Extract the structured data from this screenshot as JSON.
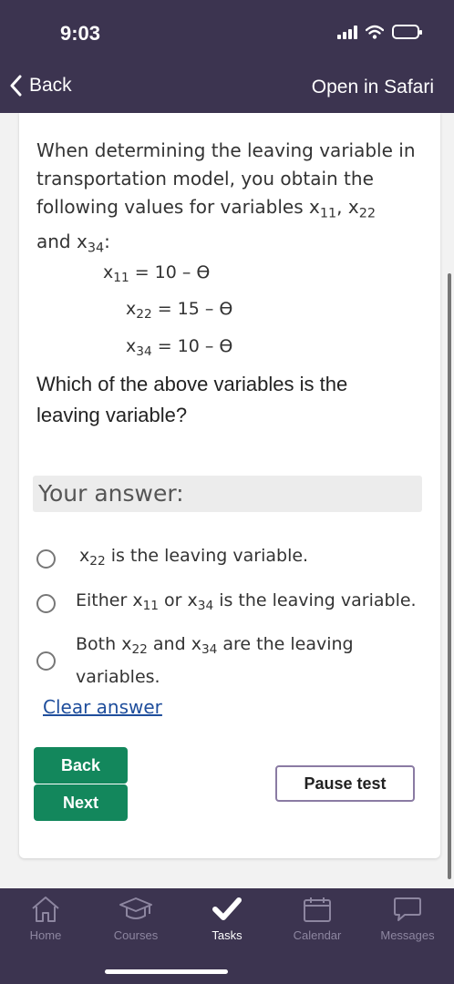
{
  "status_bar": {
    "time": "9:03"
  },
  "browser_nav": {
    "back_label": "Back",
    "open_label": "Open in Safari"
  },
  "question": {
    "intro_part1": "When determining the leaving variable in transportation model, you obtain the following values for variables ",
    "var_x11": "x",
    "sub_11": "11",
    "comma": ", ",
    "var_x22": "x",
    "sub_22": "22",
    "and_text": "and ",
    "var_x34": "x",
    "sub_34": "34",
    "colon": ":",
    "equations": [
      {
        "var": "x",
        "sub": "11",
        "rhs": " = 10 – ϴ"
      },
      {
        "var": "x",
        "sub": "22",
        "rhs": " = 15 – ϴ"
      },
      {
        "var": "x",
        "sub": "34",
        "rhs": " = 10 – ϴ"
      }
    ],
    "prompt": "Which of the above variables is the leaving variable?"
  },
  "answer_section": {
    "heading": "Your answer:",
    "options": [
      {
        "v1": "x",
        "s1": "22",
        "rest": " is the leaving variable."
      },
      {
        "pre": "Either ",
        "v1": "x",
        "s1": "11",
        "mid": " or ",
        "v2": "x",
        "s2": "34",
        "rest": " is the leaving variable."
      },
      {
        "pre": "Both ",
        "v1": "x",
        "s1": "22",
        "mid": " and ",
        "v2": "x",
        "s2": "34",
        "rest": " are the leaving variables."
      }
    ],
    "clear_label": "Clear answer"
  },
  "buttons": {
    "back": "Back",
    "next": "Next",
    "pause": "Pause test"
  },
  "tab_bar": {
    "items": [
      {
        "label": "Home",
        "icon": "home-icon"
      },
      {
        "label": "Courses",
        "icon": "graduation-cap-icon"
      },
      {
        "label": "Tasks",
        "icon": "checkmark-icon",
        "active": true
      },
      {
        "label": "Calendar",
        "icon": "calendar-icon"
      },
      {
        "label": "Messages",
        "icon": "chat-bubble-icon"
      }
    ]
  },
  "colors": {
    "header_bg": "#3c3450",
    "primary_button": "#13875c",
    "outline_button": "#8a7ba3",
    "link": "#1f4e9c"
  }
}
